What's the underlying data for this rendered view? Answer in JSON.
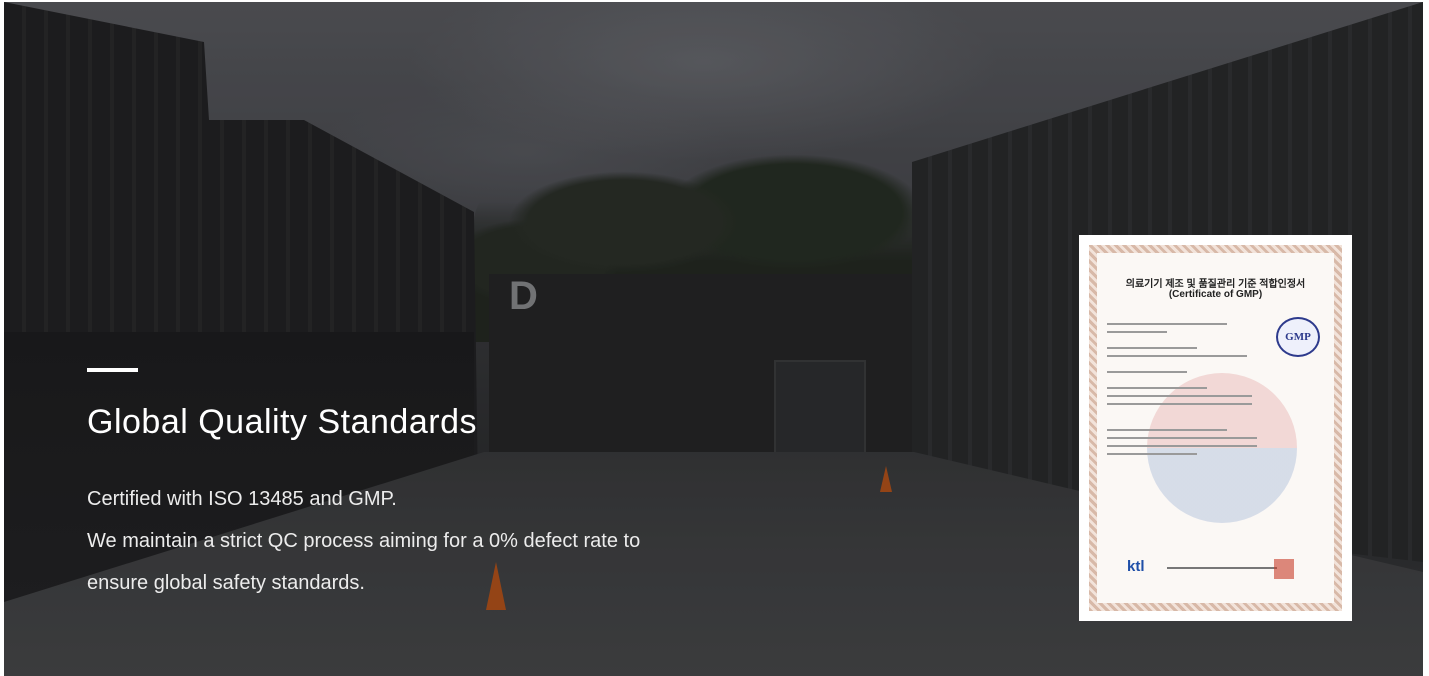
{
  "hero": {
    "title": "Global Quality Standards",
    "description": [
      "Certified with ISO 13485 and GMP.",
      "We maintain a strict QC process aiming for a 0% defect rate to",
      "ensure global safety standards."
    ],
    "accent_color": "#ffffff"
  },
  "certificate": {
    "title_kr": "의료기기 제조 및 품질관리 기준 적합인정서",
    "title_en": "(Certificate of GMP)",
    "badge": "GMP",
    "issuer_logo": "ktl"
  },
  "scene": {
    "building_letter": "D"
  }
}
